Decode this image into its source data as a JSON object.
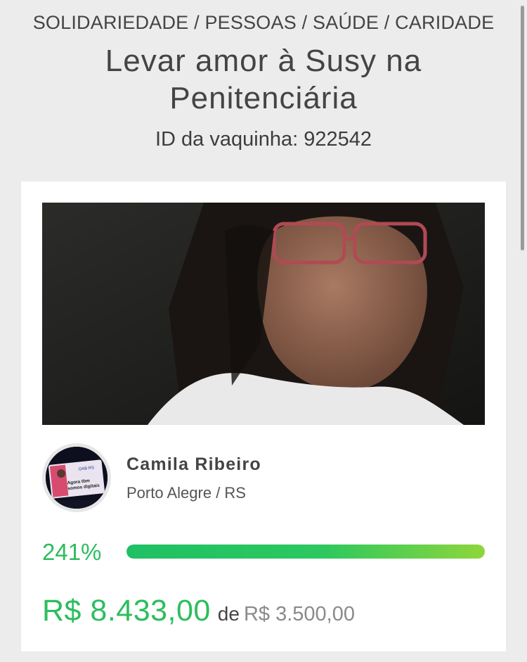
{
  "header": {
    "categories": "SOLIDARIEDADE / PESSOAS / SAÚDE / CARIDADE",
    "title": "Levar amor à Susy na Penitenciária",
    "campaign_id": "ID da vaquinha: 922542"
  },
  "organizer": {
    "name": "Camila Ribeiro",
    "location": "Porto Alegre / RS",
    "avatar_text": [
      "OAB RS",
      "Agora tbm",
      "somos digitais"
    ]
  },
  "progress": {
    "percent_label": "241%",
    "fill_fraction": 1.0
  },
  "funding": {
    "raised": "R$ 8.433,00",
    "connector": "de",
    "goal": "R$ 3.500,00"
  },
  "colors": {
    "background": "#ececec",
    "accent_green": "#2ebd5e",
    "progress_end": "#8fd63b",
    "muted_text": "#8a8a8a"
  }
}
